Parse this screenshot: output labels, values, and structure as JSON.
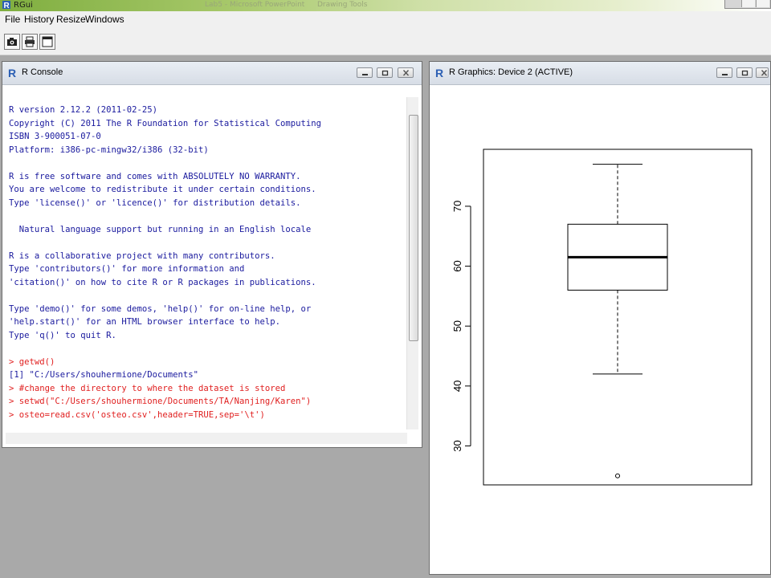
{
  "app": {
    "title": "RGui",
    "ghost_titles": [
      "Lab5 - Microsoft PowerPoint",
      "Drawing Tools"
    ]
  },
  "menu": [
    "File",
    "History",
    "Resize",
    "Windows"
  ],
  "toolbar": {
    "buttons": [
      {
        "name": "open-script-button",
        "icon": "camera-icon"
      },
      {
        "name": "print-button",
        "icon": "printer-icon"
      },
      {
        "name": "window-button",
        "icon": "window-icon"
      }
    ]
  },
  "console": {
    "title": "R Console",
    "lines": [
      {
        "type": "out",
        "text": "R version 2.12.2 (2011-02-25)"
      },
      {
        "type": "out",
        "text": "Copyright (C) 2011 The R Foundation for Statistical Computing"
      },
      {
        "type": "out",
        "text": "ISBN 3-900051-07-0"
      },
      {
        "type": "out",
        "text": "Platform: i386-pc-mingw32/i386 (32-bit)"
      },
      {
        "type": "out",
        "text": ""
      },
      {
        "type": "out",
        "text": "R is free software and comes with ABSOLUTELY NO WARRANTY."
      },
      {
        "type": "out",
        "text": "You are welcome to redistribute it under certain conditions."
      },
      {
        "type": "out",
        "text": "Type 'license()' or 'licence()' for distribution details."
      },
      {
        "type": "out",
        "text": ""
      },
      {
        "type": "out",
        "text": "  Natural language support but running in an English locale"
      },
      {
        "type": "out",
        "text": ""
      },
      {
        "type": "out",
        "text": "R is a collaborative project with many contributors."
      },
      {
        "type": "out",
        "text": "Type 'contributors()' for more information and"
      },
      {
        "type": "out",
        "text": "'citation()' on how to cite R or R packages in publications."
      },
      {
        "type": "out",
        "text": ""
      },
      {
        "type": "out",
        "text": "Type 'demo()' for some demos, 'help()' for on-line help, or"
      },
      {
        "type": "out",
        "text": "'help.start()' for an HTML browser interface to help."
      },
      {
        "type": "out",
        "text": "Type 'q()' to quit R."
      },
      {
        "type": "out",
        "text": ""
      },
      {
        "type": "in",
        "text": "> getwd()"
      },
      {
        "type": "out",
        "text": "[1] \"C:/Users/shouhermione/Documents\""
      },
      {
        "type": "in",
        "text": "> #change the directory to where the dataset is stored"
      },
      {
        "type": "in",
        "text": "> setwd(\"C:/Users/shouhermione/Documents/TA/Nanjing/Karen\")"
      },
      {
        "type": "in",
        "text": "> osteo=read.csv('osteo.csv',header=TRUE,sep='\\t')"
      }
    ]
  },
  "graphics": {
    "title": "R Graphics: Device 2 (ACTIVE)"
  },
  "chart_data": {
    "type": "boxplot",
    "title": "",
    "xlabel": "",
    "ylabel": "",
    "ylim": [
      23.5,
      79.5
    ],
    "yticks": [
      30,
      40,
      50,
      60,
      70
    ],
    "ytick_labels": [
      "30",
      "40",
      "50",
      "60",
      "70"
    ],
    "box": {
      "lower_whisker": 42,
      "q1": 56,
      "median": 61.5,
      "q3": 67,
      "upper_whisker": 77
    },
    "outliers": [
      25
    ],
    "grid": false
  },
  "colors": {
    "console_output": "#1a1a9e",
    "console_input": "#e01f1f",
    "workspace": "#a9a9a9"
  }
}
